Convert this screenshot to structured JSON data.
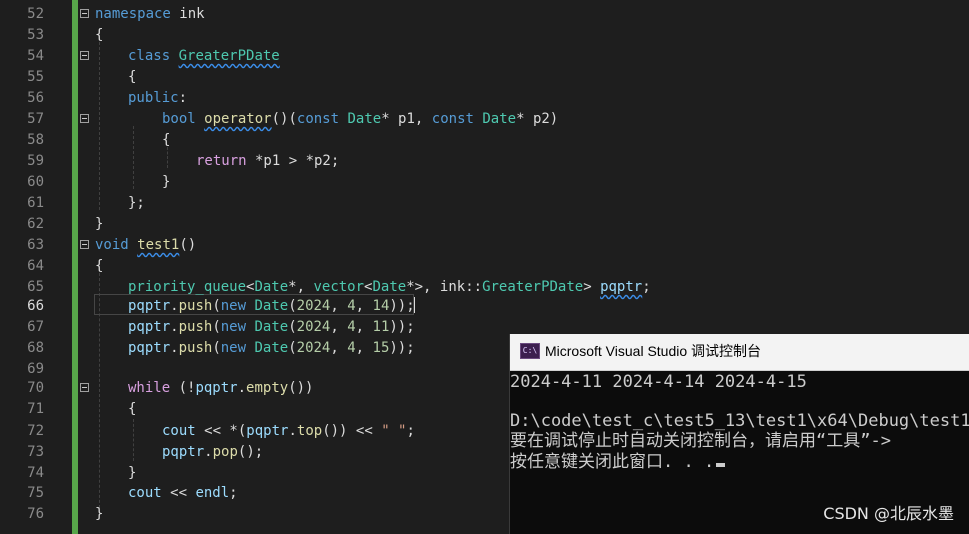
{
  "editor": {
    "current_line": "66",
    "lines": [
      {
        "n": "52"
      },
      {
        "n": "53"
      },
      {
        "n": "54"
      },
      {
        "n": "55"
      },
      {
        "n": "56"
      },
      {
        "n": "57"
      },
      {
        "n": "58"
      },
      {
        "n": "59"
      },
      {
        "n": "60"
      },
      {
        "n": "61"
      },
      {
        "n": "62"
      },
      {
        "n": "63"
      },
      {
        "n": "64"
      },
      {
        "n": "65"
      },
      {
        "n": "66"
      },
      {
        "n": "67"
      },
      {
        "n": "68"
      },
      {
        "n": "69"
      },
      {
        "n": "70"
      },
      {
        "n": "71"
      },
      {
        "n": "72"
      },
      {
        "n": "73"
      },
      {
        "n": "74"
      },
      {
        "n": "75"
      },
      {
        "n": "76"
      }
    ],
    "code": {
      "l52": {
        "kw": "namespace",
        "name": " ink"
      },
      "l53": "{",
      "l54": {
        "kw": "class",
        "name": "GreaterPDate"
      },
      "l55": "{",
      "l56": {
        "kw": "public",
        "p": ":"
      },
      "l57": {
        "t1": "bool",
        "fn": "operator",
        "p1": "()(",
        "k1": "const",
        "ty1": "Date",
        "p2": "* p1, ",
        "k2": "const",
        "ty2": "Date",
        "p3": "* p2)"
      },
      "l58": "{",
      "l59": {
        "kw": "return",
        "rest": " *p1 > *p2;"
      },
      "l60": "}",
      "l61": "};",
      "l62": "}",
      "l63": {
        "kw": "void",
        "fn": "test1",
        "p": "()"
      },
      "l64": "{",
      "l65": {
        "ty1": "priority_queue",
        "a": "<",
        "ty2": "Date",
        "b": "*, ",
        "ty3": "vector",
        "c": "<",
        "ty4": "Date",
        "d": "*>, ink::",
        "ty5": "GreaterPDate",
        "e": "> ",
        "var": "pqptr",
        "f": ";"
      },
      "l66": {
        "var": "pqptr",
        "dot": ".",
        "fn": "push",
        "p1": "(",
        "kw": "new",
        "ty": "Date",
        "p2": "(",
        "n1": "2024",
        "s1": ", ",
        "n2": "4",
        "s2": ", ",
        "n3": "14",
        "p3": "));"
      },
      "l67": {
        "var": "pqptr",
        "dot": ".",
        "fn": "push",
        "p1": "(",
        "kw": "new",
        "ty": "Date",
        "p2": "(",
        "n1": "2024",
        "s1": ", ",
        "n2": "4",
        "s2": ", ",
        "n3": "11",
        "p3": "));"
      },
      "l68": {
        "var": "pqptr",
        "dot": ".",
        "fn": "push",
        "p1": "(",
        "kw": "new",
        "ty": "Date",
        "p2": "(",
        "n1": "2024",
        "s1": ", ",
        "n2": "4",
        "s2": ", ",
        "n3": "15",
        "p3": "));"
      },
      "l70": {
        "kw": "while",
        "p1": " (!",
        "var": "pqptr",
        "dot": ".",
        "fn": "empty",
        "p2": "())"
      },
      "l71": "{",
      "l72": {
        "v1": "cout",
        "op": " << *(",
        "var": "pqptr",
        "dot": ".",
        "fn": "top",
        "p": "()) << ",
        "str": "\" \"",
        "end": ";"
      },
      "l73": {
        "var": "pqptr",
        "dot": ".",
        "fn": "pop",
        "p": "();"
      },
      "l74": "}",
      "l75": {
        "v1": "cout",
        "op": " << ",
        "v2": "endl",
        "end": ";"
      },
      "l76": "}"
    }
  },
  "console": {
    "title": "Microsoft Visual Studio 调试控制台",
    "icon_text": "C:\\",
    "lines": [
      "2024-4-11 2024-4-14 2024-4-15",
      "",
      "D:\\code\\test_c\\test5_13\\test1\\x64\\Debug\\test1.",
      "要在调试停止时自动关闭控制台，请启用“工具”->",
      "按任意键关闭此窗口. . ."
    ]
  },
  "watermark": "CSDN @北辰水墨"
}
